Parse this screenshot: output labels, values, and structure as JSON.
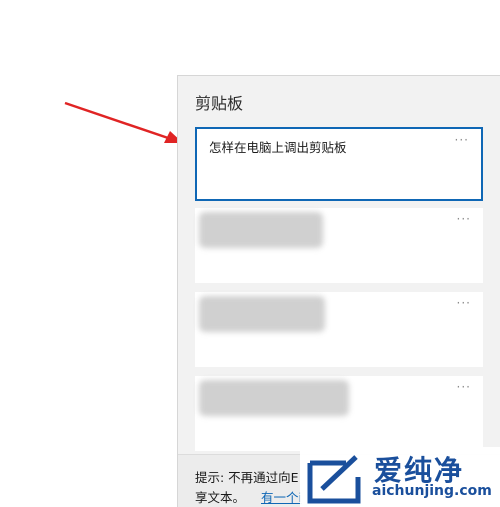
{
  "clipboard": {
    "title": "剪贴板",
    "items": [
      {
        "text": "怎样在电脑上调出剪贴板",
        "more": "···"
      },
      {
        "more": "···"
      },
      {
        "more": "···"
      },
      {
        "more": "···"
      }
    ],
    "tip": {
      "line1": "提示: 不再通过向E",
      "line2_prefix": "享文本。",
      "link": "有一个i"
    }
  },
  "watermark": {
    "cn": "爱纯净",
    "en": "aichunjing.com"
  },
  "colors": {
    "accent": "#0f67b5",
    "arrow": "#e02424",
    "watermark": "#1a4f9c"
  }
}
